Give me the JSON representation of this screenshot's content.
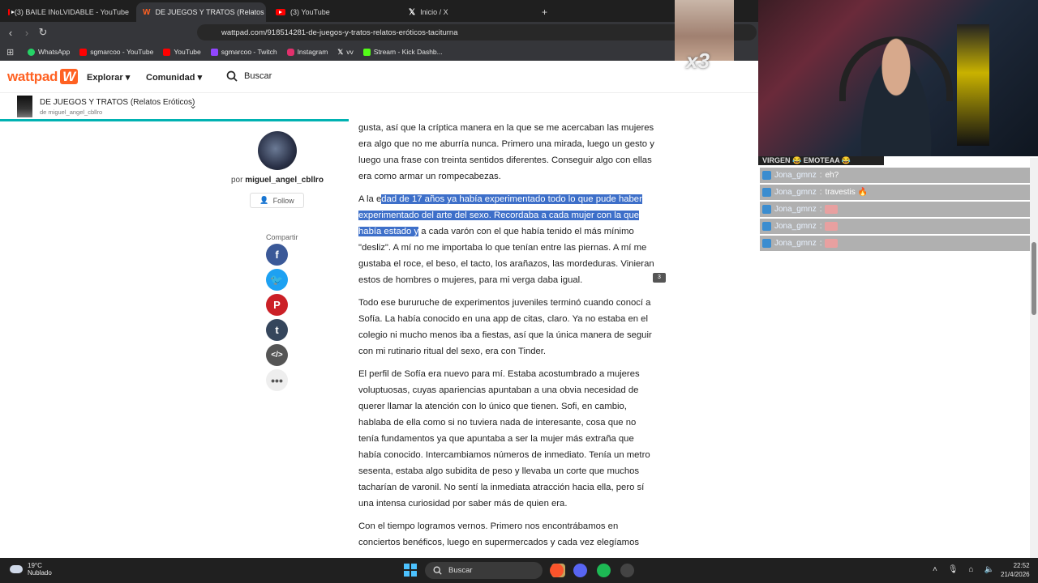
{
  "browser": {
    "tabs": [
      {
        "label": "(3) BAILE INoLVIDABLE - YouTube",
        "icon": "youtube-icon"
      },
      {
        "label": "DE JUEGOS Y TRATOS (Relatos E",
        "icon": "wattpad-icon"
      },
      {
        "label": "(3) YouTube",
        "icon": "youtube-icon"
      },
      {
        "label": "Inicio / X",
        "icon": "x-icon"
      }
    ],
    "new_tab": "+",
    "url": "wattpad.com/918514281-de-juegos-y-tratos-relatos-eróticos-taciturna",
    "bookmarks": [
      "WhatsApp",
      "sgmarcoo - YouTube",
      "YouTube",
      "sgmarcoo - Twitch",
      "Instagram",
      "vv",
      "Stream - Kick Dashb..."
    ]
  },
  "header": {
    "logo": "wattpad",
    "explore": "Explorar",
    "community": "Comunidad",
    "search": "Buscar"
  },
  "story": {
    "title": "DE JUEGOS Y TRATOS (Relatos Eróticos)",
    "author": "de miguel_angel_cbllro",
    "progress_percent": 46
  },
  "sidebar": {
    "by": "por",
    "username": "miguel_angel_cbllro",
    "follow": "Follow",
    "share_label": "Compartir"
  },
  "article": {
    "p0": "gusta, así que la críptica manera en la que se me acercaban las mujeres era algo que no me aburría nunca. Primero una mirada, luego un gesto y luego una frase con treinta sentidos diferentes. Conseguir algo con ellas era como armar un rompecabezas.",
    "p1_pre": "A la e",
    "p1_sel": "dad de 17 años ya había experimentado todo lo que pude haber experimentado del arte del sexo. Recordaba a cada mujer con la que había estado y",
    "p1_post": "a cada varón con el que había tenido el más mínimo \"desliz\". A mí no me importaba lo que tenían entre las piernas. A mí me gustaba el roce, el beso, el tacto, los arañazos, las mordeduras. Vinieran estos de hombres o mujeres, para mi verga daba igual.",
    "comment_count": "3",
    "p2": "Todo ese bururuche de experimentos juveniles terminó cuando conocí a Sofía. La había conocido en una app de citas, claro. Ya no estaba en el colegio ni mucho menos iba a fiestas, así que la única manera de seguir con mi rutinario ritual del sexo, era con Tinder.",
    "p3": "El perfil de Sofía era nuevo para mí. Estaba acostumbrado a mujeres voluptuosas, cuyas apariencias apuntaban a una obvia necesidad de querer llamar la atención con lo único que tienen. Sofi, en cambio, hablaba de ella como si no tuviera nada de interesante, cosa que no tenía fundamentos ya que apuntaba a ser la mujer más extraña que había conocido. Intercambiamos números de inmediato. Tenía un metro sesenta, estaba algo subidita de peso y llevaba un corte que muchos tacharían de varonil. No sentí la inmediata atracción hacia ella, pero sí una intensa curiosidad por saber más de quien era.",
    "p4": "Con el tiempo logramos vernos. Primero nos encontrábamos en conciertos benéficos, luego en supermercados y cada vez elegíamos"
  },
  "stream": {
    "multiplier": "x3",
    "emote_strip": "VIRGEN 😂 EMOTEAA 😂",
    "chat": [
      {
        "user": "Jona_gmnz",
        "sep": ":",
        "message": "eh?"
      },
      {
        "user": "Jona_gmnz",
        "sep": ":",
        "message": "travestis 🔥"
      },
      {
        "user": "Jona_gmnz",
        "sep": ":",
        "message": ""
      },
      {
        "user": "Jona_gmnz",
        "sep": ":",
        "message": ""
      },
      {
        "user": "Jona_gmnz",
        "sep": ":",
        "message": ""
      }
    ]
  },
  "taskbar": {
    "temp": "19°C",
    "weather": "Nublado",
    "search": "Buscar",
    "time": "22:52",
    "date": "21/4/2026"
  },
  "colors": {
    "wattpad_orange": "#ff6122",
    "progress_teal": "#00b2b2",
    "selection": "#3d6fc9"
  }
}
